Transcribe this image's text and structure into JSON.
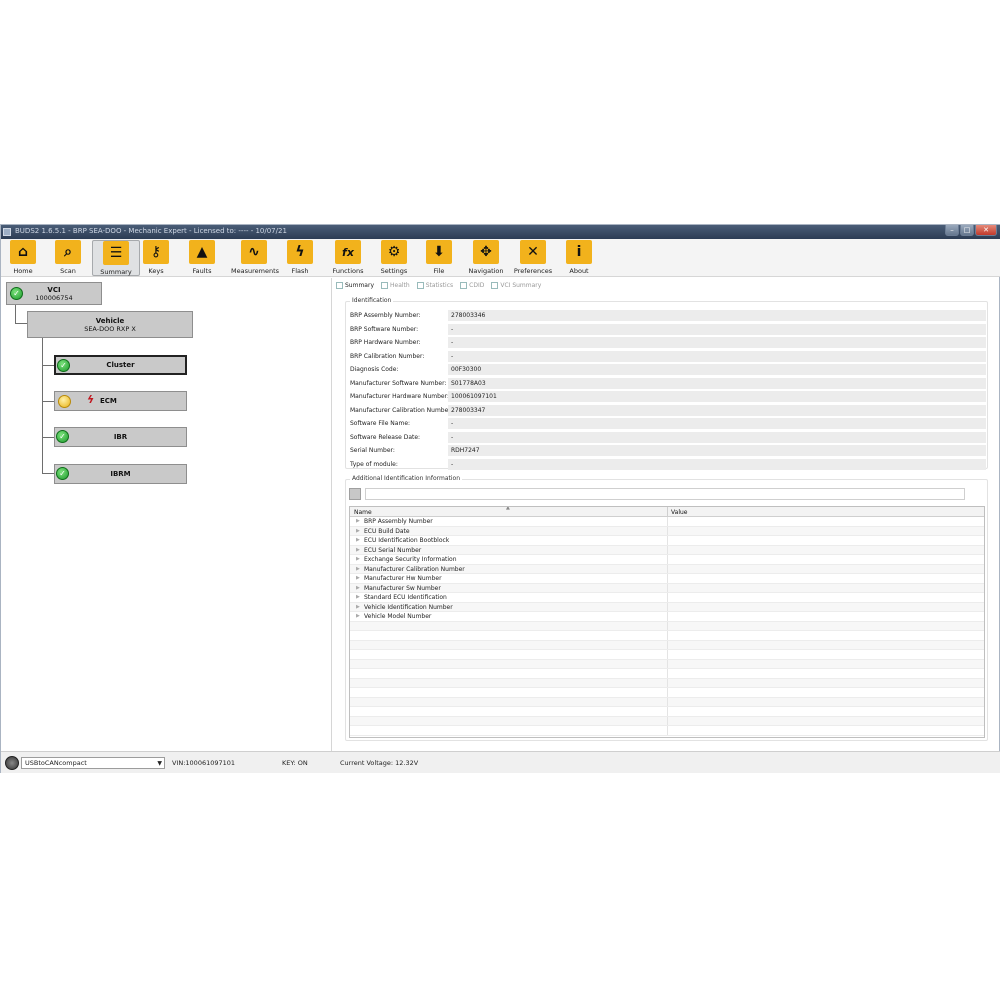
{
  "window": {
    "title": "BUDS2 1.6.5.1 - BRP SEA-DOO - Mechanic Expert - Licensed to: ---- - 10/07/21"
  },
  "toolbar": [
    {
      "label": "Home",
      "icon": "home-icon"
    },
    {
      "label": "Scan",
      "icon": "scan-icon"
    },
    {
      "label": "Summary",
      "icon": "summary-icon",
      "active": true
    },
    {
      "label": "Keys",
      "icon": "key-icon"
    },
    {
      "label": "Faults",
      "icon": "warning-icon"
    },
    {
      "label": "Measurements",
      "icon": "chart-icon"
    },
    {
      "label": "Flash",
      "icon": "lightning-icon"
    },
    {
      "label": "Functions",
      "icon": "fx-icon"
    },
    {
      "label": "Settings",
      "icon": "gear-icon"
    },
    {
      "label": "File",
      "icon": "file-icon"
    },
    {
      "label": "Navigation",
      "icon": "navigation-icon"
    },
    {
      "label": "Preferences",
      "icon": "tools-icon"
    },
    {
      "label": "About",
      "icon": "info-icon"
    }
  ],
  "tree": {
    "vci": {
      "title": "VCI",
      "sub": "100006754"
    },
    "vehicle": {
      "title": "Vehicle",
      "sub": "SEA-DOO RXP X"
    },
    "modules": [
      {
        "label": "Cluster",
        "status": "ok"
      },
      {
        "label": "ECM",
        "status": "warning"
      },
      {
        "label": "IBR",
        "status": "ok"
      },
      {
        "label": "IBRM",
        "status": "ok"
      }
    ]
  },
  "tabs": [
    "Summary",
    "Health",
    "Statistics",
    "CDID",
    "VCI Summary"
  ],
  "identification": {
    "title": "Identification",
    "rows": [
      {
        "key": "BRP Assembly Number:",
        "value": "278003346"
      },
      {
        "key": "BRP Software Number:",
        "value": "-"
      },
      {
        "key": "BRP Hardware Number:",
        "value": "-"
      },
      {
        "key": "BRP Calibration Number:",
        "value": "-"
      },
      {
        "key": "Diagnosis Code:",
        "value": "00F30300"
      },
      {
        "key": "Manufacturer Software Number:",
        "value": "S01778A03"
      },
      {
        "key": "Manufacturer Hardware Number:",
        "value": "100061097101"
      },
      {
        "key": "Manufacturer Calibration Number:",
        "value": "278003347"
      },
      {
        "key": "Software File Name:",
        "value": "-"
      },
      {
        "key": "Software Release Date:",
        "value": "-"
      },
      {
        "key": "Serial Number:",
        "value": "RDH7247"
      },
      {
        "key": "Type of module:",
        "value": "-"
      }
    ]
  },
  "additional": {
    "title": "Additional Identification Information",
    "search_value": "",
    "columns": [
      "Name",
      "Value"
    ],
    "rows": [
      "BRP Assembly Number",
      "ECU Build Date",
      "ECU Identification Bootblock",
      "ECU Serial Number",
      "Exchange Security Information",
      "Manufacturer Calibration Number",
      "Manufacturer Hw Number",
      "Manufacturer Sw Number",
      "Standard ECU Identification",
      "Vehicle Identification Number",
      "Vehicle Model Number"
    ]
  },
  "status": {
    "interface": "USBtoCANcompact",
    "vin": "VIN:100061097101",
    "key": "KEY: ON",
    "voltage": "Current Voltage: 12.32V"
  }
}
